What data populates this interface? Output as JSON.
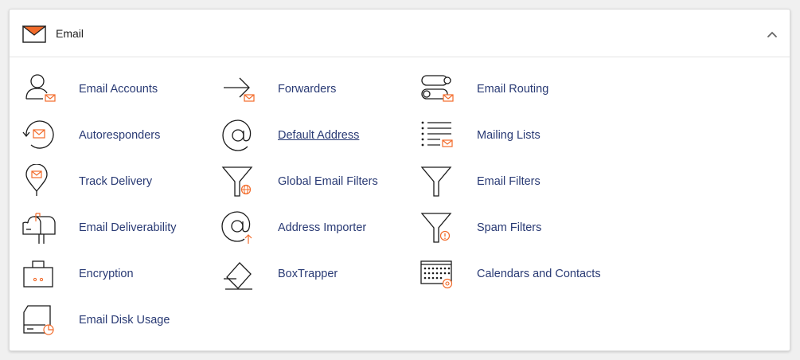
{
  "section": {
    "title": "Email",
    "icon": "envelope-icon",
    "collapse_icon": "chevron-up-icon"
  },
  "colors": {
    "link": "#293a74",
    "icon_line": "#1b1b1b",
    "accent": "#f26b2a",
    "panel_bg": "#ffffff"
  },
  "items": [
    {
      "label": "Email Accounts",
      "icon": "email-accounts-icon"
    },
    {
      "label": "Forwarders",
      "icon": "forwarders-icon"
    },
    {
      "label": "Email Routing",
      "icon": "email-routing-icon"
    },
    {
      "label": "Autoresponders",
      "icon": "autoresponders-icon"
    },
    {
      "label": "Default Address",
      "icon": "default-address-icon"
    },
    {
      "label": "Mailing Lists",
      "icon": "mailing-lists-icon"
    },
    {
      "label": "Track Delivery",
      "icon": "track-delivery-icon"
    },
    {
      "label": "Global Email Filters",
      "icon": "global-email-filters-icon"
    },
    {
      "label": "Email Filters",
      "icon": "email-filters-icon"
    },
    {
      "label": "Email Deliverability",
      "icon": "email-deliverability-icon"
    },
    {
      "label": "Address Importer",
      "icon": "address-importer-icon"
    },
    {
      "label": "Spam Filters",
      "icon": "spam-filters-icon"
    },
    {
      "label": "Encryption",
      "icon": "encryption-icon"
    },
    {
      "label": "BoxTrapper",
      "icon": "boxtrapper-icon"
    },
    {
      "label": "Calendars and Contacts",
      "icon": "calendars-contacts-icon"
    },
    {
      "label": "Email Disk Usage",
      "icon": "email-disk-usage-icon"
    }
  ]
}
